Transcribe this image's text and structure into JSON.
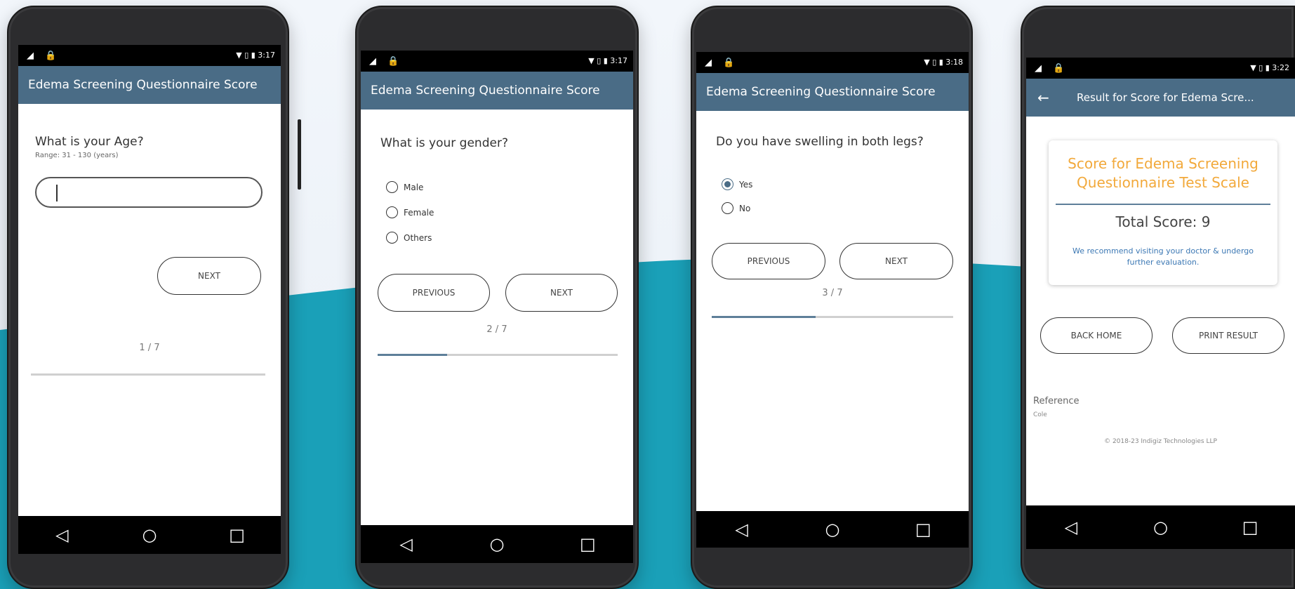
{
  "colors": {
    "teal_bg": "#1aa0b8",
    "app_bar": "#4a6c86",
    "accent_orange": "#f2a93b",
    "link_blue": "#3c78b4"
  },
  "status_bar": {
    "left_icons": "◢ 🔒",
    "right_icons": [
      "▼ ▯ ▮ 3:17",
      "▼ ▯ ▮ 3:17",
      "▼ ▯ ▮ 3:18",
      "▼ ▯ ▮ 3:22"
    ]
  },
  "nav_icons": {
    "back": "◁",
    "home": "○",
    "recent": "□"
  },
  "screen1": {
    "title": "Edema Screening Questionnaire Score",
    "question": "What is your Age?",
    "hint": "Range: 31 - 130 (years)",
    "input_value": "",
    "next_label": "NEXT",
    "counter": "1 / 7",
    "progress": 0
  },
  "screen2": {
    "title": "Edema Screening Questionnaire Score",
    "question": "What is your gender?",
    "options": [
      "Male",
      "Female",
      "Others"
    ],
    "previous_label": "PREVIOUS",
    "next_label": "NEXT",
    "counter": "2 / 7",
    "progress": 0.29
  },
  "screen3": {
    "title": "Edema Screening Questionnaire Score",
    "question": "Do you have swelling in both legs?",
    "options": [
      "Yes",
      "No"
    ],
    "selected": "Yes",
    "previous_label": "PREVIOUS",
    "next_label": "NEXT",
    "counter": "3 / 7",
    "progress": 0.43
  },
  "screen4": {
    "back_arrow": "←",
    "title": "Result for Score for Edema Scre...",
    "card_title": "Score for Edema Screening Questionnaire Test Scale",
    "total_score": "Total Score: 9",
    "recommendation": "We recommend visiting your doctor & undergo further evaluation.",
    "back_home_label": "BACK HOME",
    "print_label": "PRINT RESULT",
    "reference_label": "Reference",
    "reference_text": "Cole",
    "copyright": "© 2018-23 Indigiz Technologies LLP"
  }
}
